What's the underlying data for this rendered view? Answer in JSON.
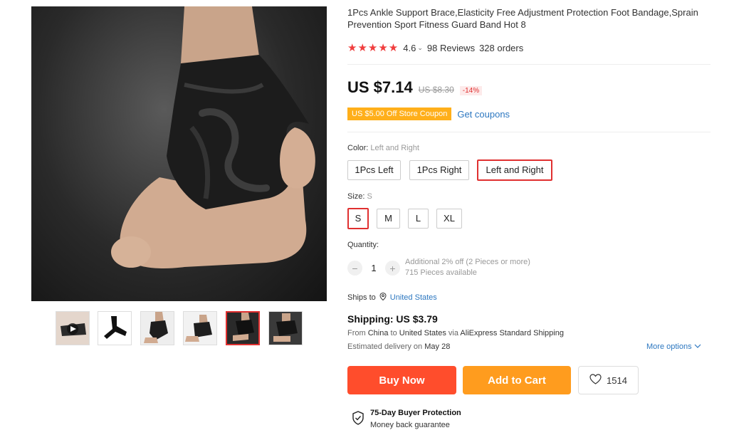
{
  "product": {
    "title": "1Pcs Ankle Support Brace,Elasticity Free Adjustment Protection Foot Bandage,Sprain Prevention Sport Fitness Guard Band Hot 8",
    "rating": "4.6",
    "rating_stars": 5,
    "reviews": "98 Reviews",
    "orders": "328 orders"
  },
  "price": {
    "current": "US $7.14",
    "original": "US $8.30",
    "discount": "-14%"
  },
  "coupon": {
    "tag": "US $5.00 Off Store Coupon",
    "link": "Get coupons"
  },
  "color": {
    "label": "Color:",
    "selected": "Left and Right",
    "options": [
      "1Pcs Left",
      "1Pcs Right",
      "Left and Right"
    ]
  },
  "size": {
    "label": "Size:",
    "selected": "S",
    "options": [
      "S",
      "M",
      "L",
      "XL"
    ]
  },
  "quantity": {
    "label": "Quantity:",
    "value": "1",
    "minus": "−",
    "plus": "+",
    "additional": "Additional 2% off (2 Pieces or more)",
    "available": "715 Pieces available"
  },
  "shipping": {
    "ships_to": "Ships to",
    "country": "United States",
    "title": "Shipping: US $3.79",
    "from_label": "From",
    "from": "China",
    "to_label": "to",
    "to": "United States",
    "via_label": "via",
    "via": "AliExpress Standard Shipping",
    "delivery_label": "Estimated delivery on",
    "delivery_date": "May 28",
    "more_options": "More options"
  },
  "actions": {
    "buy_now": "Buy Now",
    "add_to_cart": "Add to Cart",
    "wishlist_count": "1514"
  },
  "protection": {
    "title": "75-Day Buyer Protection",
    "subtitle": "Money back guarantee"
  },
  "colors": {
    "accent_red": "#ff4d2c",
    "cart_orange": "#ff9c1e",
    "link_blue": "#2c77c0",
    "star_red": "#f03d3d",
    "coupon_orange": "#ffaf1a"
  }
}
